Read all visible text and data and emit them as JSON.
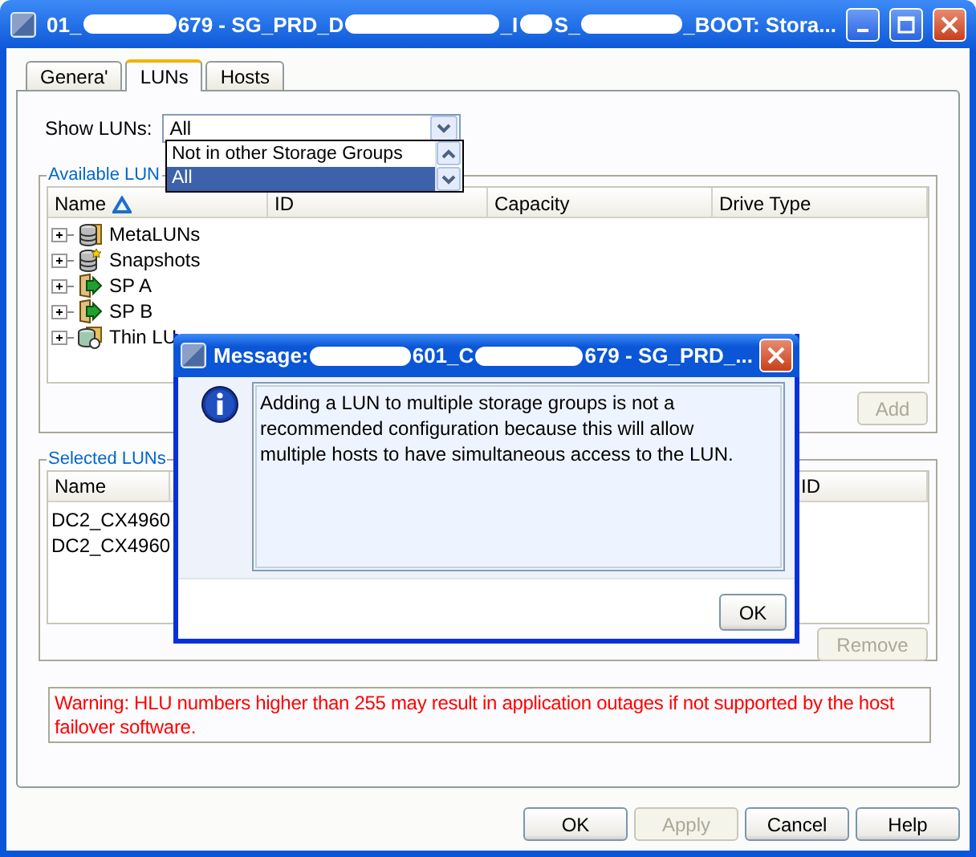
{
  "window": {
    "title_parts": [
      "01_",
      "679 - SG_PRD_D",
      "_I",
      "S_",
      "_BOOT: Stora..."
    ]
  },
  "tabs": [
    {
      "label": "Genera'",
      "selected": false
    },
    {
      "label": "LUNs",
      "selected": true
    },
    {
      "label": "Hosts",
      "selected": false
    }
  ],
  "show_luns": {
    "label": "Show LUNs:",
    "value": "All",
    "options": [
      {
        "label": "Not in other Storage Groups",
        "selected": false
      },
      {
        "label": "All",
        "selected": true
      }
    ]
  },
  "available_luns": {
    "title": "Available LUN",
    "columns": [
      "Name",
      "ID",
      "Capacity",
      "Drive Type"
    ],
    "tree": [
      {
        "label": "MetaLUNs",
        "kind": "metalun",
        "expanded": false
      },
      {
        "label": "Snapshots",
        "kind": "snapshot",
        "expanded": false
      },
      {
        "label": "SP A",
        "kind": "sp",
        "expanded": false
      },
      {
        "label": "SP B",
        "kind": "sp",
        "expanded": false
      },
      {
        "label": "Thin LU",
        "kind": "thin",
        "expanded": false
      }
    ],
    "add_button": {
      "label": "Add",
      "disabled": true
    }
  },
  "selected_luns": {
    "title": "Selected LUNs",
    "columns": [
      "Name",
      "ID"
    ],
    "rows": [
      "DC2_CX4960",
      "DC2_CX4960"
    ],
    "remove_button": {
      "label": "Remove",
      "disabled": true
    }
  },
  "warning": "Warning: HLU numbers higher than 255 may result in application outages if not supported by the host failover software.",
  "buttons": [
    {
      "label": "OK",
      "disabled": false
    },
    {
      "label": "Apply",
      "disabled": true
    },
    {
      "label": "Cancel",
      "disabled": false
    },
    {
      "label": "Help",
      "disabled": false
    }
  ],
  "dialog": {
    "title_parts": [
      "Message:",
      "601_C",
      "679 - SG_PRD_..."
    ],
    "message": "Adding a LUN to multiple storage groups is not a recommended configuration because this will allow multiple hosts to have simultaneous access to the LUN.",
    "button": {
      "label": "OK"
    }
  }
}
